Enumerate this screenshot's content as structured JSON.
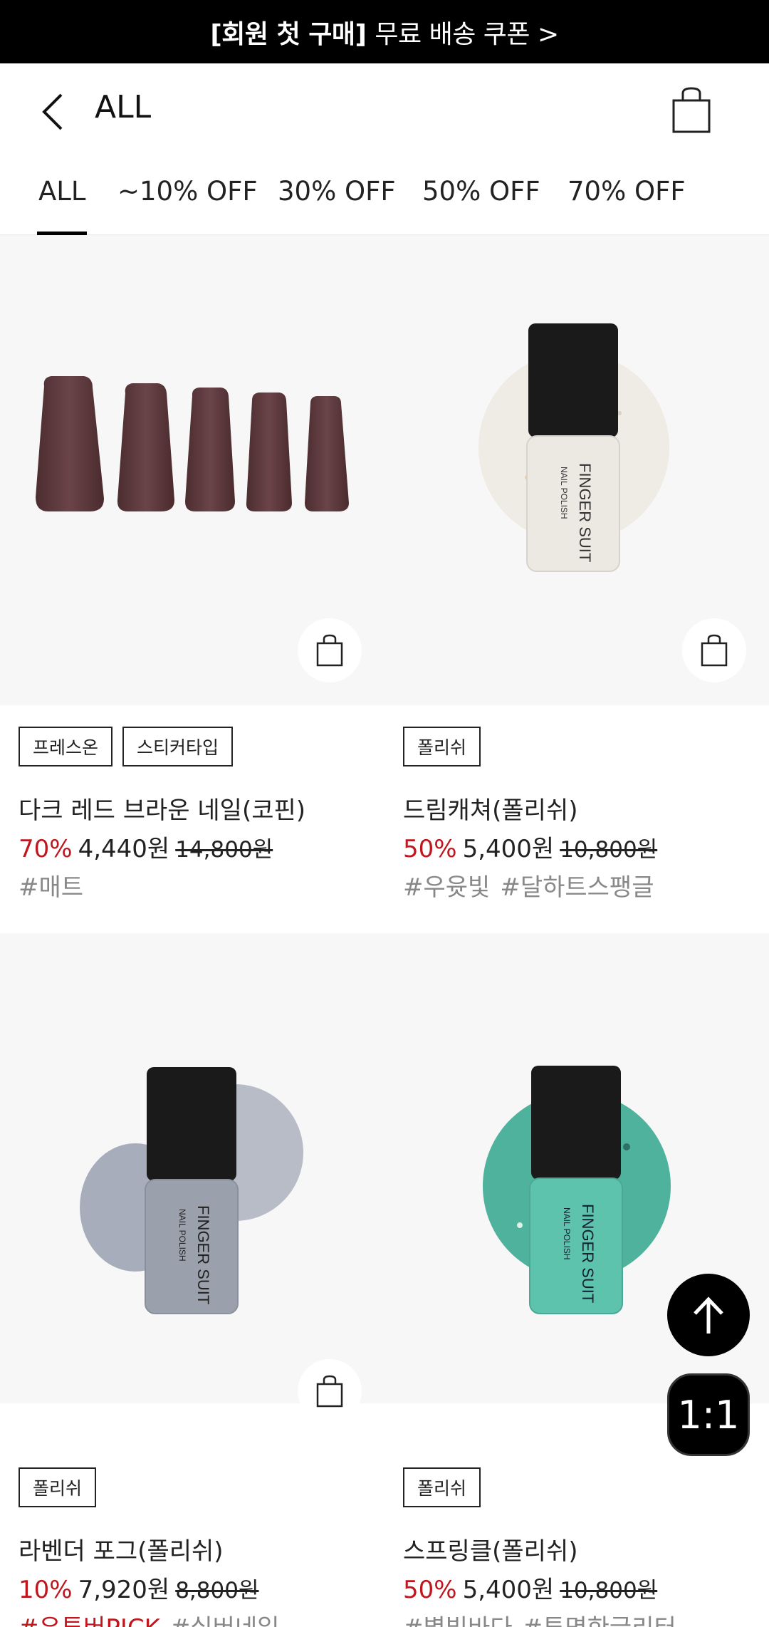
{
  "promo": {
    "bold": "[회원 첫 구매]",
    "text": "무료 배송 쿠폰 >"
  },
  "header": {
    "title": "ALL"
  },
  "tabs": [
    {
      "label": "ALL",
      "active": true
    },
    {
      "label": "~10% OFF",
      "active": false
    },
    {
      "label": "30% OFF",
      "active": false
    },
    {
      "label": "50% OFF",
      "active": false
    },
    {
      "label": "70% OFF",
      "active": false
    }
  ],
  "products": [
    {
      "tags": [
        "프레스온",
        "스티커타입"
      ],
      "name": "다크 레드 브라운 네일(코핀)",
      "discount": "70%",
      "price": "4,440원",
      "original": "14,800원",
      "hashtags": [
        "#매트"
      ],
      "image": "press-on-nails-dark-red-brown",
      "color": "#5e3a3d"
    },
    {
      "tags": [
        "폴리쉬"
      ],
      "name": "드림캐쳐(폴리쉬)",
      "discount": "50%",
      "price": "5,400원",
      "original": "10,800원",
      "hashtags": [
        "#우윳빛",
        "#달하트스팽글"
      ],
      "image": "nail-polish-milky-glitter",
      "color": "#eeeae4"
    },
    {
      "tags": [
        "폴리쉬"
      ],
      "name": "라벤더 포그(폴리쉬)",
      "discount": "10%",
      "price": "7,920원",
      "original": "8,800원",
      "hashtags": [
        "#유튜버PICK",
        "#실버네일"
      ],
      "image": "nail-polish-silver-lavender",
      "color": "#a8aebb"
    },
    {
      "tags": [
        "폴리쉬"
      ],
      "name": "스프링클(폴리쉬)",
      "discount": "50%",
      "price": "5,400원",
      "original": "10,800원",
      "hashtags": [
        "#별빛바다",
        "#투명한글리터"
      ],
      "image": "nail-polish-green-glitter",
      "color": "#5ec3ad"
    }
  ],
  "bottle_brand": {
    "line1": "FINGER SUIT",
    "line2": "NAIL POLISH"
  },
  "fab": {
    "chat": "1:1"
  },
  "colors": {
    "accent_red": "#c0161e",
    "black": "#000000",
    "background_gray": "#f7f7f7"
  }
}
